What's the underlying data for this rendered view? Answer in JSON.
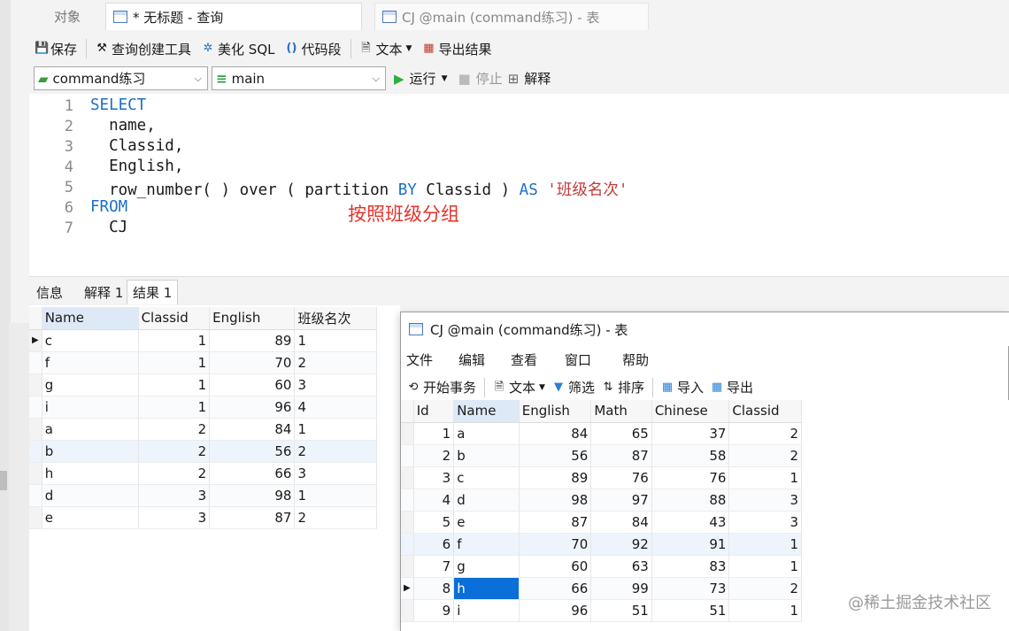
{
  "tabs": {
    "objects": "对象",
    "query": "* 无标题 - 查询",
    "table": "CJ @main (command练习) - 表"
  },
  "toolbar": {
    "save": "保存",
    "query_builder": "查询创建工具",
    "beautify": "美化 SQL",
    "snippet": "代码段",
    "text": "文本",
    "export": "导出结果"
  },
  "selectors": {
    "connection": "command练习",
    "database": "main",
    "run": "运行",
    "stop": "停止",
    "explain": "解释"
  },
  "editor": {
    "line_numbers": [
      "1",
      "2",
      "3",
      "4",
      "5",
      "6",
      "7"
    ],
    "l1": "SELECT",
    "l2": "  name,",
    "l3": "  Classid,",
    "l4": "  English,",
    "l5_a": "  row_number( ) over ( partition ",
    "l5_by": "BY",
    "l5_b": " Classid ) ",
    "l5_as": "AS",
    "l5_c": " ",
    "l5_str": "'班级名次'",
    "l6": "FROM",
    "l7": "  CJ",
    "annotation": "按照班级分组"
  },
  "result_tabs": {
    "info": "信息",
    "explain": "解释 1",
    "result": "结果 1"
  },
  "result_grid": {
    "columns": [
      "Name",
      "Classid",
      "English",
      "班级名次"
    ],
    "rows": [
      [
        "c",
        "1",
        "89",
        "1"
      ],
      [
        "f",
        "1",
        "70",
        "2"
      ],
      [
        "g",
        "1",
        "60",
        "3"
      ],
      [
        "i",
        "1",
        "96",
        "4"
      ],
      [
        "a",
        "2",
        "84",
        "1"
      ],
      [
        "b",
        "2",
        "56",
        "2"
      ],
      [
        "h",
        "2",
        "66",
        "3"
      ],
      [
        "d",
        "3",
        "98",
        "1"
      ],
      [
        "e",
        "3",
        "87",
        "2"
      ]
    ]
  },
  "table_window": {
    "title": "CJ @main (command练习) - 表",
    "menu": [
      "文件",
      "编辑",
      "查看",
      "窗口",
      "帮助"
    ],
    "tools": {
      "begin_tx": "开始事务",
      "text": "文本",
      "filter": "筛选",
      "sort": "排序",
      "import": "导入",
      "export": "导出"
    },
    "columns": [
      "Id",
      "Name",
      "English",
      "Math",
      "Chinese",
      "Classid"
    ],
    "rows": [
      [
        "1",
        "a",
        "84",
        "65",
        "37",
        "2"
      ],
      [
        "2",
        "b",
        "56",
        "87",
        "58",
        "2"
      ],
      [
        "3",
        "c",
        "89",
        "76",
        "76",
        "1"
      ],
      [
        "4",
        "d",
        "98",
        "97",
        "88",
        "3"
      ],
      [
        "5",
        "e",
        "87",
        "84",
        "43",
        "3"
      ],
      [
        "6",
        "f",
        "70",
        "92",
        "91",
        "1"
      ],
      [
        "7",
        "g",
        "60",
        "63",
        "83",
        "1"
      ],
      [
        "8",
        "h",
        "66",
        "99",
        "73",
        "2"
      ],
      [
        "9",
        "i",
        "96",
        "51",
        "51",
        "1"
      ]
    ]
  },
  "watermark": "@稀土掘金技术社区",
  "colors": {
    "keyword": "#1b6fc8",
    "string": "#c23a3a",
    "annotation": "#e5332a",
    "selection": "#0a6fd8"
  }
}
